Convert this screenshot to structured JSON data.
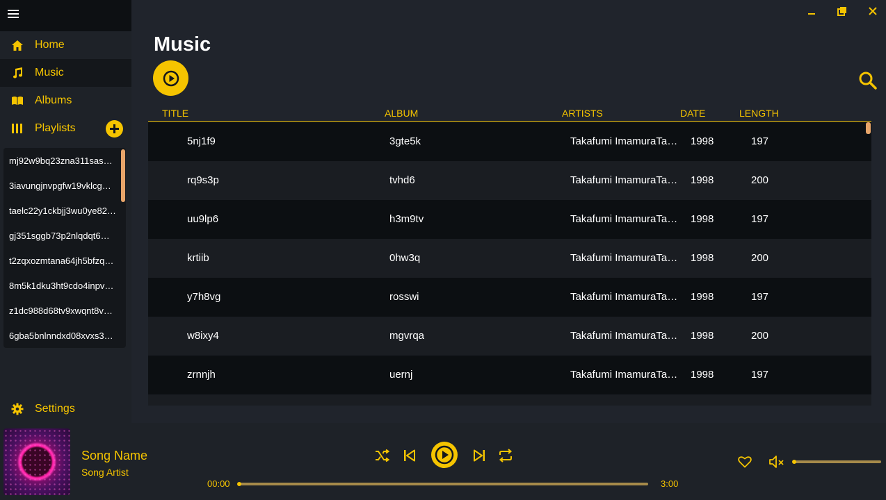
{
  "colors": {
    "accent": "#f5c400",
    "background": "#1e2228"
  },
  "sidebar": {
    "menu_icon": "hamburger-icon",
    "nav": [
      {
        "label": "Home",
        "icon": "home-icon"
      },
      {
        "label": "Music",
        "icon": "music-note-icon"
      },
      {
        "label": "Albums",
        "icon": "book-icon"
      },
      {
        "label": "Playlists",
        "icon": "library-icon"
      }
    ],
    "playlists": [
      "mj92w9bq23zna311sas…",
      "3iavungjnvpgfw19vklcg…",
      "taelc22y1ckbjj3wu0ye82…",
      "gj351sggb73p2nlqdqt6…",
      "t2zqxozmtana64jh5bfzq…",
      "8m5k1dku3ht9cdo4inpv…",
      "z1dc988d68tv9xwqnt8v…",
      "6gba5bnlnndxd08xvxs3…"
    ],
    "settings_label": "Settings"
  },
  "main": {
    "title": "Music",
    "columns": [
      "TITLE",
      "ALBUM",
      "ARTISTS",
      "DATE",
      "LENGTH"
    ],
    "rows": [
      {
        "title": "5nj1f9",
        "album": "3gte5k",
        "artist": "Takafumi ImamuraTa…",
        "date": "1998",
        "length": "197"
      },
      {
        "title": "rq9s3p",
        "album": "tvhd6",
        "artist": "Takafumi ImamuraTa…",
        "date": "1998",
        "length": "200"
      },
      {
        "title": "uu9lp6",
        "album": "h3m9tv",
        "artist": "Takafumi ImamuraTa…",
        "date": "1998",
        "length": "197"
      },
      {
        "title": "krtiib",
        "album": "0hw3q",
        "artist": "Takafumi ImamuraTa…",
        "date": "1998",
        "length": "200"
      },
      {
        "title": "y7h8vg",
        "album": "rosswi",
        "artist": "Takafumi ImamuraTa…",
        "date": "1998",
        "length": "197"
      },
      {
        "title": "w8ixy4",
        "album": "mgvrqa",
        "artist": "Takafumi ImamuraTa…",
        "date": "1998",
        "length": "200"
      },
      {
        "title": "zrnnjh",
        "album": "uernj",
        "artist": "Takafumi ImamuraTa…",
        "date": "1998",
        "length": "197"
      },
      {
        "title": "",
        "album": "",
        "artist": "",
        "date": "",
        "length": ""
      }
    ]
  },
  "player": {
    "song_name": "Song Name",
    "song_artist": "Song Artist",
    "current_time": "00:00",
    "total_time": "3:00",
    "progress": 0,
    "volume": 0
  }
}
